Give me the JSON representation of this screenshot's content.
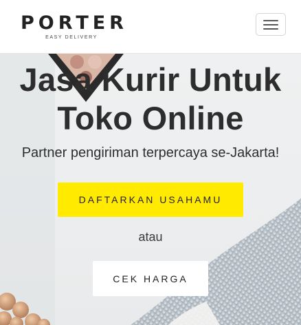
{
  "navbar": {
    "brand_name": "PORTER",
    "brand_tagline": "EASY DELIVERY"
  },
  "hero": {
    "title_line1": "Jasa Kurir Untuk",
    "title_line2": "Toko Online",
    "subtitle": "Partner pengiriman terpercaya se-Jakarta!",
    "primary_cta": "DAFTARKAN USAHAMU",
    "or_text": "atau",
    "secondary_cta": "CEK HARGA"
  },
  "colors": {
    "accent_yellow": "#ffea00",
    "text_dark": "#2d2d2d",
    "navbar_bg": "#ffffff"
  },
  "icons": [
    "hamburger-menu-icon"
  ]
}
